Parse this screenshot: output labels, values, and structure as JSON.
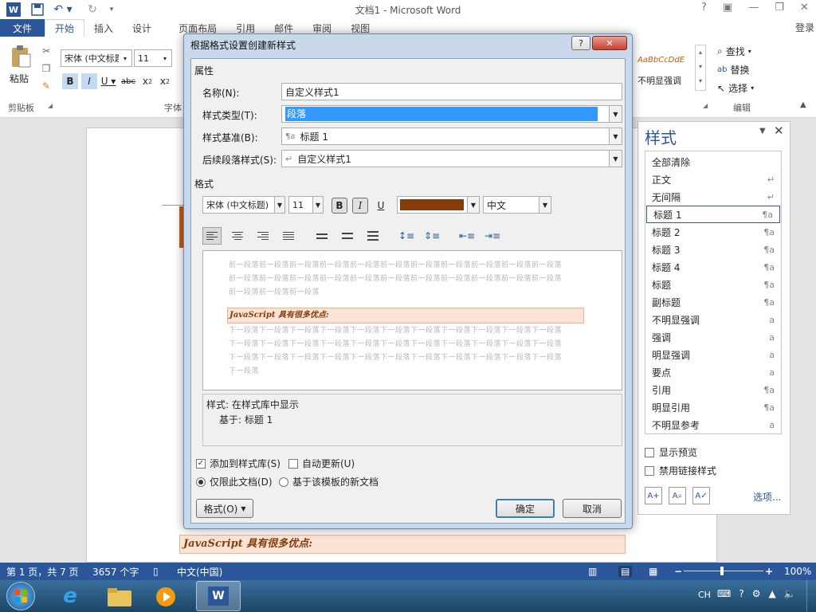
{
  "window": {
    "title": "文档1 - Microsoft Word",
    "login": "登录"
  },
  "ribbon": {
    "tabs": [
      {
        "label": "文件"
      },
      {
        "label": "开始"
      },
      {
        "label": "插入"
      },
      {
        "label": "设计"
      },
      {
        "label": "页面布局"
      },
      {
        "label": "引用"
      },
      {
        "label": "邮件"
      },
      {
        "label": "审阅"
      },
      {
        "label": "视图"
      }
    ],
    "paste": "粘贴",
    "clipboard_group": "剪贴板",
    "font_group": "字体",
    "font_name": "宋体 (中文标题",
    "font_size": "11",
    "style_gallery_sample": "AaBbCcDdE",
    "style_gallery_name": "不明显强调",
    "find": "查找",
    "replace": "替换",
    "select": "选择",
    "edit_group": "编辑"
  },
  "dialog": {
    "title": "根据格式设置创建新样式",
    "help": "?",
    "properties_header": "属性",
    "name_label": "名称(N):",
    "name_value": "自定义样式1",
    "type_label": "样式类型(T):",
    "type_value": "段落",
    "based_label": "样式基准(B):",
    "based_value": "标题 1",
    "next_label": "后续段落样式(S):",
    "next_value": "自定义样式1",
    "format_header": "格式",
    "font_value": "宋体 (中文标题)",
    "size_value": "11",
    "bold": "B",
    "italic": "I",
    "underline": "U",
    "font_color": "#843c0c",
    "lang_value": "中文",
    "preview_prev": [
      "前一段落前一段落前一段落前一段落前一段落前一段落前一段落前一段落前一段落前一段落前一段落",
      "前一段落前一段落前一段落前一段落前一段落前一段落前一段落前一段落前一段落前一段落前一段落",
      "前一段落前一段落前一段落"
    ],
    "preview_sample": "JavaScript 具有很多优点:",
    "preview_next": [
      "下一段落下一段落下一段落下一段落下一段落下一段落下一段落下一段落下一段落下一段落下一段落",
      "下一段落下一段落下一段落下一段落下一段落下一段落下一段落下一段落下一段落下一段落下一段落",
      "下一段落下一段落下一段落下一段落下一段落下一段落下一段落下一段落下一段落下一段落下一段落",
      "下一段落"
    ],
    "desc_line1": "样式: 在样式库中显示",
    "desc_line2": "基于: 标题 1",
    "add_gallery": "添加到样式库(S)",
    "auto_update": "自动更新(U)",
    "only_doc": "仅限此文档(D)",
    "new_template": "基于该模板的新文档",
    "format_btn": "格式(O)",
    "ok": "确定",
    "cancel": "取消"
  },
  "styles_pane": {
    "title": "样式",
    "items": [
      {
        "label": "全部清除",
        "mark": ""
      },
      {
        "label": "正文",
        "mark": "↵"
      },
      {
        "label": "无间隔",
        "mark": "↵"
      },
      {
        "label": "标题 1",
        "mark": "¶a"
      },
      {
        "label": "标题 2",
        "mark": "¶a"
      },
      {
        "label": "标题 3",
        "mark": "¶a"
      },
      {
        "label": "标题 4",
        "mark": "¶a"
      },
      {
        "label": "标题",
        "mark": "¶a"
      },
      {
        "label": "副标题",
        "mark": "¶a"
      },
      {
        "label": "不明显强调",
        "mark": "a"
      },
      {
        "label": "强调",
        "mark": "a"
      },
      {
        "label": "明显强调",
        "mark": "a"
      },
      {
        "label": "要点",
        "mark": "a"
      },
      {
        "label": "引用",
        "mark": "¶a"
      },
      {
        "label": "明显引用",
        "mark": "¶a"
      },
      {
        "label": "不明显参考",
        "mark": "a"
      }
    ],
    "show_preview": "显示预览",
    "disable_linked": "禁用链接样式",
    "options": "选项..."
  },
  "document": {
    "line_text": "JavaScript 具有很多优点:"
  },
  "status": {
    "page": "第 1 页，共 7 页",
    "words": "3657 个字",
    "lang": "中文(中国)",
    "zoom": "100%"
  },
  "taskbar": {
    "ime": "CH"
  }
}
